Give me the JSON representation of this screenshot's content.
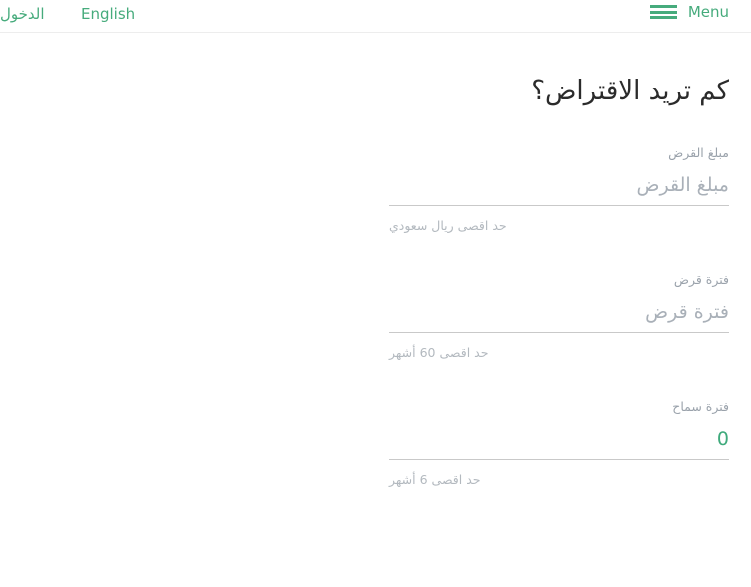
{
  "header": {
    "login_label": "الدخول",
    "language_label": "English",
    "menu_label": "Menu",
    "menu_icon": "hamburger-icon"
  },
  "main": {
    "heading": "كم تريد الاقتراض؟",
    "fields": [
      {
        "label": "مبلغ القرض",
        "placeholder": "مبلغ القرض",
        "value": "",
        "hint": "حد اقصى ريال سعودي"
      },
      {
        "label": "فترة قرض",
        "placeholder": "فترة قرض",
        "value": "",
        "hint": "حد اقصى 60 أشهر"
      },
      {
        "label": "فترة سماح",
        "placeholder": "",
        "value": "0",
        "hint": "حد اقصى 6 أشهر"
      }
    ]
  },
  "colors": {
    "accent_green": "#46ab7c",
    "text_dark": "#2b2b2b",
    "label_grey": "#9aa2ab",
    "hint_grey": "#b3b9bf",
    "underline_grey": "#c9c9c9"
  }
}
